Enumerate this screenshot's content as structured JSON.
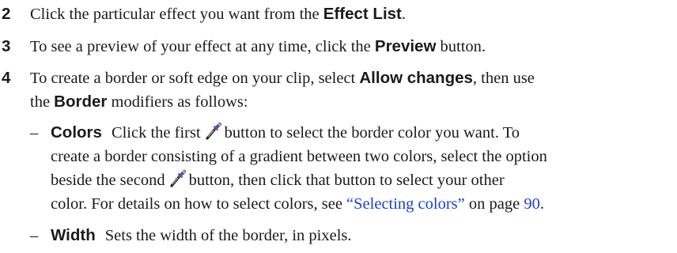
{
  "step2": {
    "num": "2",
    "pre": "Click the particular effect you want from the ",
    "bold": "Effect List",
    "post": "."
  },
  "step3": {
    "num": "3",
    "pre": "To see a preview of your effect at any time, click the ",
    "bold": "Preview",
    "post": " button."
  },
  "step4": {
    "num": "4",
    "pre": "To create a border or soft edge on your clip, select ",
    "bold1": "Allow changes",
    "mid": ", then use",
    "line2_pre": "the ",
    "bold2": "Border",
    "line2_post": " modifiers as follows:"
  },
  "colors": {
    "dash": "–",
    "label": "Colors",
    "l1_pre": "Click the first",
    "l1_post": "button to select the border color you want. To",
    "l2": "create a border consisting of a gradient between two colors, select the option",
    "l3_pre": "beside the second",
    "l3_post": "button, then click that button to select your other",
    "l4_pre": "color. For details on how to select colors, see ",
    "link1": "“Selecting colors”",
    "l4_mid": " on page ",
    "link2": "90",
    "l4_post": ".",
    "icon": "color-picker-icon"
  },
  "width": {
    "dash": "–",
    "label": "Width",
    "text": "Sets the width of the border, in pixels."
  }
}
